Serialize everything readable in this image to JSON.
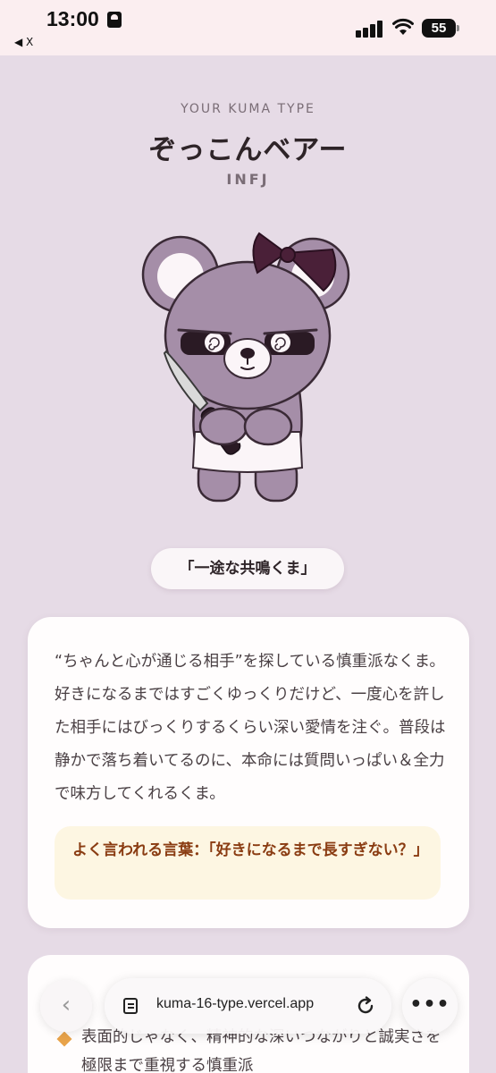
{
  "status": {
    "time": "13:00",
    "back_app": "◀ X",
    "battery": "55"
  },
  "header": {
    "kicker": "YOUR KUMA TYPE",
    "type_name": "ぞっこんベアー",
    "mbti": "INFJ"
  },
  "tagline": "「一途な共鳴くま」",
  "description": "“ちゃんと心が通じる相手”を探している慎重派なくま。好きになるまではすごくゆっくりだけど、一度心を許した相手にはびっくりするくらい深い愛情を注ぐ。普段は静かで落ち着いてるのに、本命には質問いっぱい＆全力で味方してくれるくま。",
  "quote": "よく言われる言葉：「好きになるまで長すぎない？」",
  "traits": {
    "first": "表面的じゃなく、精神的な深いつながりと誠実さを極限まで重視する慎重派"
  },
  "browser": {
    "url": "kuma-16-type.vercel.app",
    "back_glyph": "‹",
    "more_glyph": "•••"
  },
  "colors": {
    "background": "#e6dbe6",
    "bear_fur": "#a58ea8",
    "bow": "#4a2038",
    "quote_text": "#8a3c12",
    "quote_bg": "#fdf6e2",
    "bullet": "#e8a34a"
  }
}
